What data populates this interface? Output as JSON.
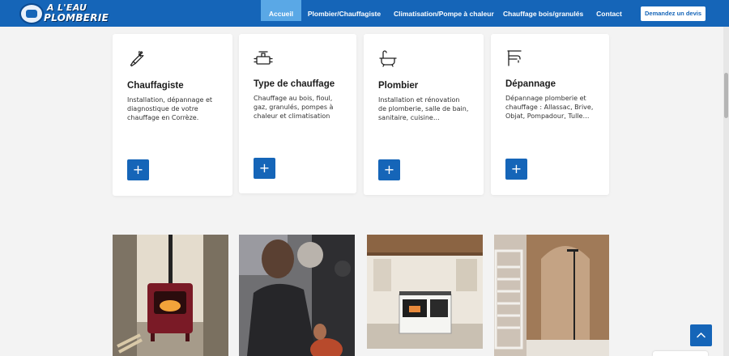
{
  "header": {
    "logo_line1": "A L'EAU",
    "logo_line2": "PLOMBERIE",
    "nav": [
      {
        "label": "Accueil",
        "active": true
      },
      {
        "label": "Plombier/Chauffagiste"
      },
      {
        "label": "Climatisation/Pompe à chaleur"
      },
      {
        "label": "Chauffage bois/granulés"
      },
      {
        "label": "Contact"
      }
    ],
    "cta_label": "Demandez un devis"
  },
  "cards": [
    {
      "icon": "wrench-icon",
      "title": "Chauffagiste",
      "desc": "Installation, dépannage et diagnostique de votre chauffage en Corrèze.",
      "button": "+"
    },
    {
      "icon": "valve-icon",
      "title": "Type de chauffage",
      "desc": "Chauffage au bois, fioul, gaz, granulés, pompes à chaleur et climatisation",
      "button": "+"
    },
    {
      "icon": "bathtub-icon",
      "title": "Plombier",
      "desc": "Installation et rénovation de plomberie, salle de bain, sanitaire, cuisine…",
      "button": "+"
    },
    {
      "icon": "faucet-icon",
      "title": "Dépannage",
      "desc": "Dépannage plomberie et chauffage : Allassac, Brive, Objat, Pompadour, Tulle…",
      "button": "+"
    }
  ],
  "photos": [
    "wood-stove-photo",
    "technician-photo",
    "kitchen-stove-photo",
    "bathroom-shower-photo"
  ],
  "colors": {
    "primary": "#1565b8",
    "active_nav": "#5aa8e6",
    "background": "#f3f3f3"
  }
}
